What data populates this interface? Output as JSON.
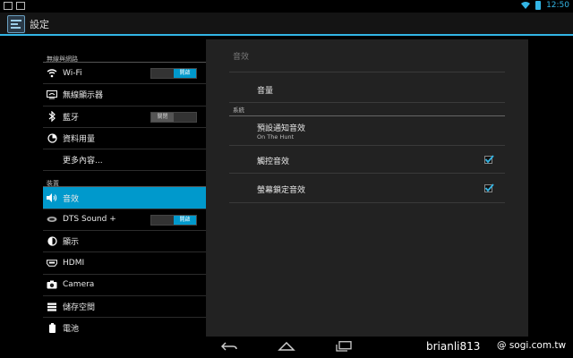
{
  "status_bar": {
    "time": "12:50"
  },
  "app": {
    "title": "設定"
  },
  "sidebar": {
    "header_wireless": "無線與網路",
    "header_device": "裝置",
    "wifi": {
      "label": "Wi-Fi",
      "toggle": "開啟"
    },
    "wireless_display": {
      "label": "無線顯示器"
    },
    "bluetooth": {
      "label": "藍牙",
      "toggle": "關閉"
    },
    "data_usage": {
      "label": "資料用量"
    },
    "more": {
      "label": "更多內容..."
    },
    "sound": {
      "label": "音效"
    },
    "dts": {
      "label": "DTS Sound +",
      "toggle": "開啟"
    },
    "display": {
      "label": "顯示"
    },
    "hdmi": {
      "label": "HDMI"
    },
    "camera": {
      "label": "Camera"
    },
    "storage": {
      "label": "儲存空間"
    },
    "battery": {
      "label": "電池"
    }
  },
  "detail": {
    "title": "音效",
    "volume": "音量",
    "system_header": "系統",
    "notification_sound": {
      "title": "預設通知音效",
      "summary": "On The Hunt"
    },
    "touch_sounds": {
      "label": "觸控音效",
      "checked": true
    },
    "screen_lock_sound": {
      "label": "螢幕鎖定音效",
      "checked": true
    }
  },
  "watermark": {
    "left": "brianli813",
    "right": "@ sogi.com.tw"
  },
  "colors": {
    "accent": "#0099cc",
    "statusbar_icons": "#33b5e5"
  }
}
